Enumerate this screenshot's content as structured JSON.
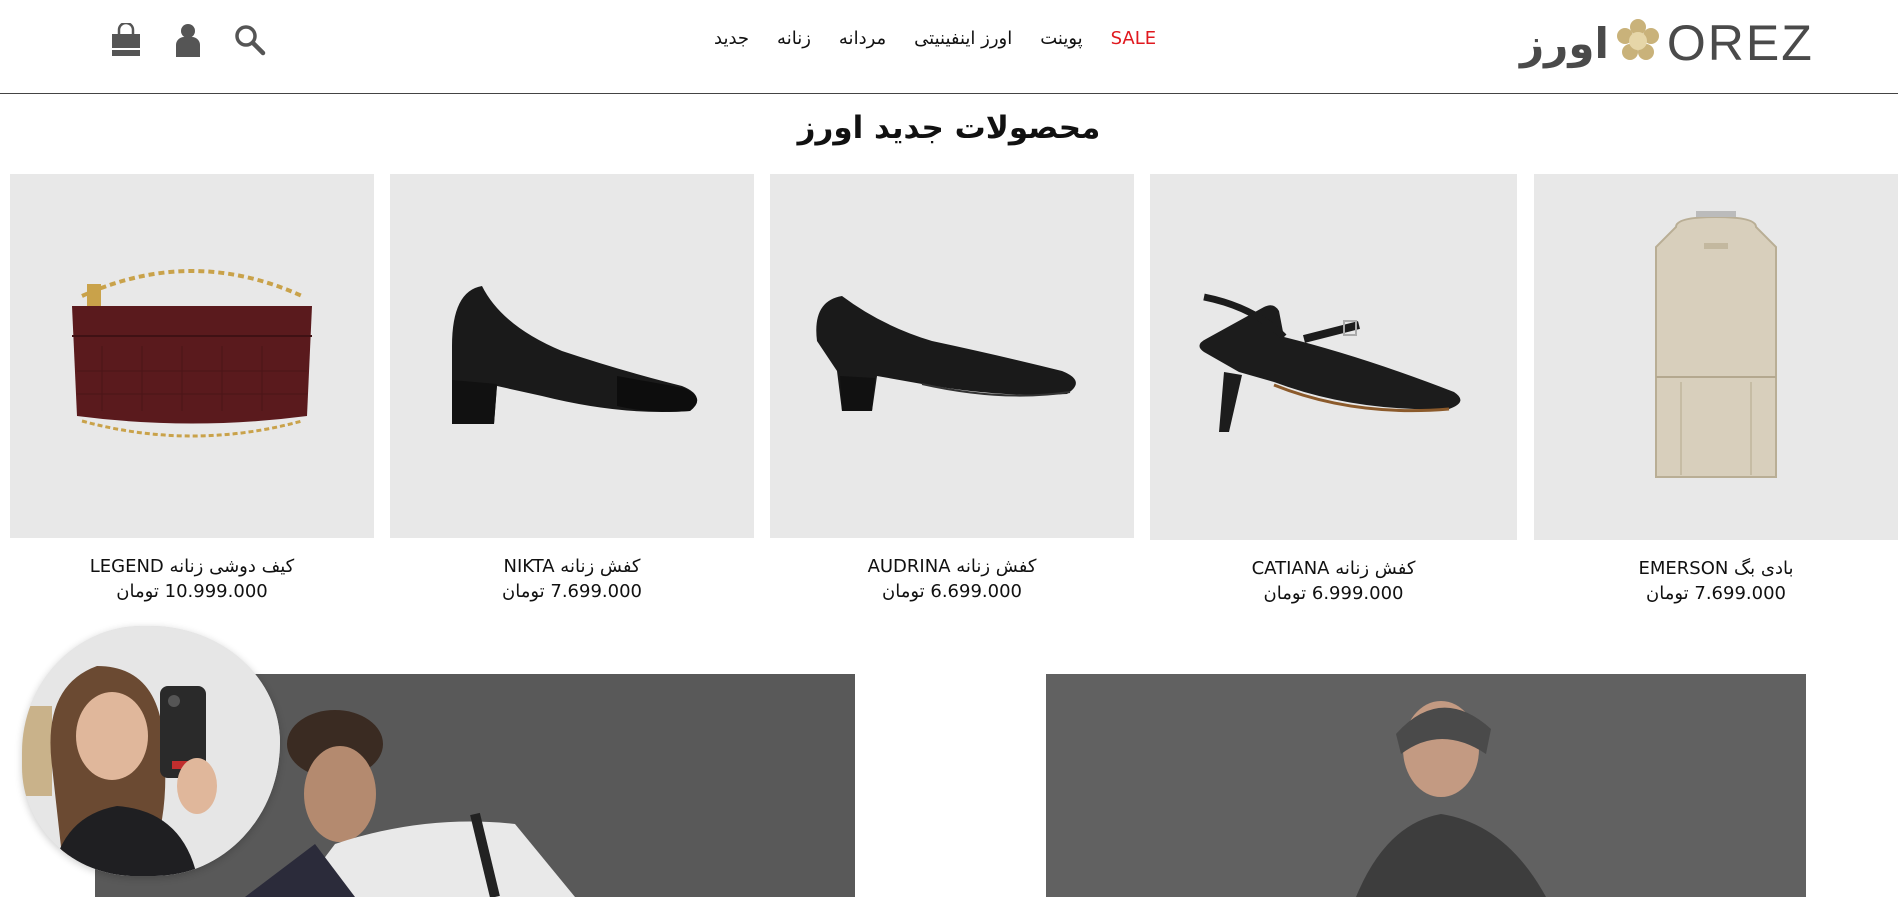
{
  "header": {
    "logo_fa": "اورز",
    "logo_en": "OREZ",
    "nav": [
      {
        "label": "جدید"
      },
      {
        "label": "زنانه"
      },
      {
        "label": "مردانه"
      },
      {
        "label": "اورز اینفینیتی"
      },
      {
        "label": "پوینت"
      },
      {
        "label": "SALE"
      }
    ],
    "icons": [
      "search-icon",
      "user-icon",
      "shopping-bag-icon"
    ]
  },
  "section": {
    "title": "محصولات جدید اورز"
  },
  "products": [
    {
      "name": "بادی بگ EMERSON",
      "price": "7.699.000 تومان",
      "image": "beige-backpack"
    },
    {
      "name": "کفش زنانه CATIANA",
      "price": "6.999.000 تومان",
      "image": "black-slingback-heel"
    },
    {
      "name": "کفش زنانه AUDRINA",
      "price": "6.699.000 تومان",
      "image": "black-block-heel-pump"
    },
    {
      "name": "کفش زنانه NIKTA",
      "price": "7.699.000 تومان",
      "image": "black-block-heel-pump-cap-toe"
    },
    {
      "name": "کیف دوشی زنانه LEGEND",
      "price": "10.999.000 تومان",
      "image": "burgundy-croc-shoulder-bag"
    }
  ],
  "colors": {
    "sale": "#e0191f",
    "card_bg": "#e8e8e8",
    "logo": "#4a4a4a",
    "logo_flower": "#c9b27a"
  }
}
